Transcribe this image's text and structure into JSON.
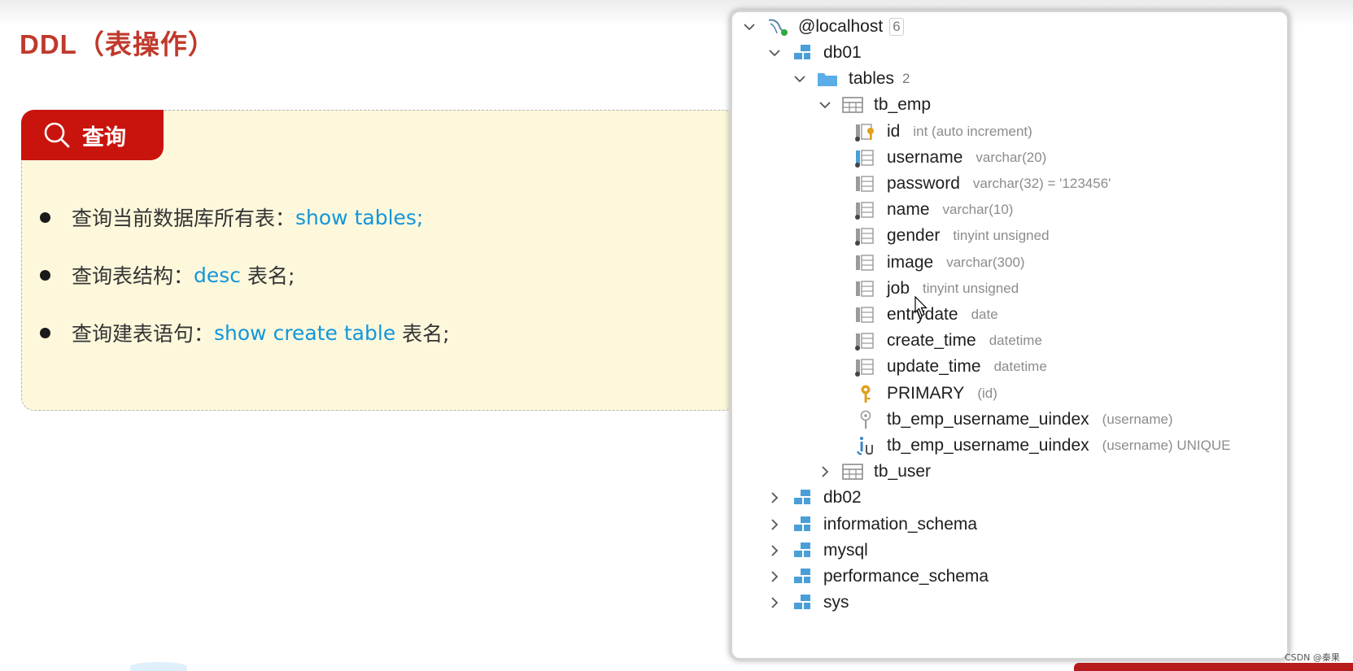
{
  "slide": {
    "title": "DDL（表操作）",
    "section_label": "查询",
    "bullets": [
      {
        "text": "查询当前数据库所有表：",
        "keyword": "show tables;",
        "suffix": ""
      },
      {
        "text": "查询表结构：",
        "keyword": "desc",
        "suffix": " 表名;"
      },
      {
        "text": "查询建表语句：",
        "keyword": "show create table",
        "suffix": " 表名;"
      }
    ]
  },
  "tree": {
    "host": {
      "name": "@localhost",
      "count": "6"
    },
    "db01": {
      "name": "db01"
    },
    "tables": {
      "name": "tables",
      "count": "2"
    },
    "tb_emp": {
      "name": "tb_emp"
    },
    "columns": [
      {
        "name": "id",
        "type": "int (auto increment)",
        "icon": "primary-key-column-icon"
      },
      {
        "name": "username",
        "type": "varchar(20)",
        "icon": "unique-column-icon"
      },
      {
        "name": "password",
        "type": "varchar(32) = '123456'",
        "icon": "column-icon"
      },
      {
        "name": "name",
        "type": "varchar(10)",
        "icon": "not-null-column-icon"
      },
      {
        "name": "gender",
        "type": "tinyint unsigned",
        "icon": "not-null-column-icon"
      },
      {
        "name": "image",
        "type": "varchar(300)",
        "icon": "column-icon"
      },
      {
        "name": "job",
        "type": "tinyint unsigned",
        "icon": "column-icon"
      },
      {
        "name": "entrydate",
        "type": "date",
        "icon": "column-icon"
      },
      {
        "name": "create_time",
        "type": "datetime",
        "icon": "not-null-column-icon"
      },
      {
        "name": "update_time",
        "type": "datetime",
        "icon": "not-null-column-icon"
      }
    ],
    "keys": [
      {
        "name": "PRIMARY",
        "detail": "(id)",
        "icon": "key-icon"
      },
      {
        "name": "tb_emp_username_uindex",
        "detail": "(username)",
        "icon": "unique-key-icon"
      },
      {
        "name": "tb_emp_username_uindex",
        "detail": "(username) UNIQUE",
        "icon": "index-icon"
      }
    ],
    "tb_user": {
      "name": "tb_user"
    },
    "other_dbs": [
      "db02",
      "information_schema",
      "mysql",
      "performance_schema",
      "sys"
    ]
  },
  "watermark": "CSDN @秦果",
  "colors": {
    "accent_red": "#c9140e",
    "keyword_blue": "#1296db",
    "card_bg": "#fdf8dc",
    "icon_blue": "#4a9fd8"
  }
}
